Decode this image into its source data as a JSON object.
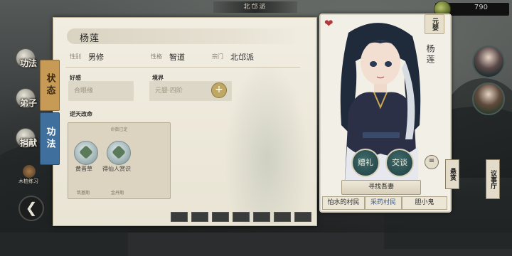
{
  "top": {
    "title": "北邙派",
    "currency_value": "790",
    "currency_icon": "turtle-coin-icon"
  },
  "left_nav": {
    "items": [
      {
        "label": "功法",
        "icon": "scroll-orb-icon"
      },
      {
        "label": "弟子",
        "icon": "disciple-orb-icon"
      },
      {
        "label": "捐献",
        "icon": "donate-orb-icon"
      }
    ],
    "practice_label": "木桩练习",
    "back_icon": "back-arrow-icon"
  },
  "panel": {
    "tabs": {
      "status": "状态",
      "skill": "功法"
    },
    "name": "杨莲",
    "attrs": [
      {
        "key": "性别",
        "value": "男修"
      },
      {
        "key": "性格",
        "value": "智道"
      },
      {
        "key": "宗门",
        "value": "北邙派"
      }
    ],
    "affection": {
      "title": "好感",
      "value": "合眼缘"
    },
    "realm": {
      "title": "境界",
      "value": "元婴·四阶"
    },
    "fate": {
      "title": "逆天改命",
      "header": "命数已定",
      "items": [
        {
          "label": "黄晋草",
          "sub": "筑基期"
        },
        {
          "label": "得仙人赏识",
          "sub": "金丹期"
        }
      ]
    }
  },
  "card": {
    "realm_tag": "元婴",
    "name": "杨莲",
    "gift_label": "赠礼",
    "talk_label": "交谈",
    "seek_label": "寻找吾妻",
    "relations": [
      "怕水的村民",
      "采药村民",
      "胆小鬼"
    ]
  },
  "right": {
    "sign_reward": "悬赏",
    "sign_discuss": "议事厅"
  },
  "colors": {
    "panel_bg": "#f1ede1",
    "tab_status": "#c79a56",
    "tab_skill": "#3f6f9c",
    "card_btn": "#2f5556"
  }
}
